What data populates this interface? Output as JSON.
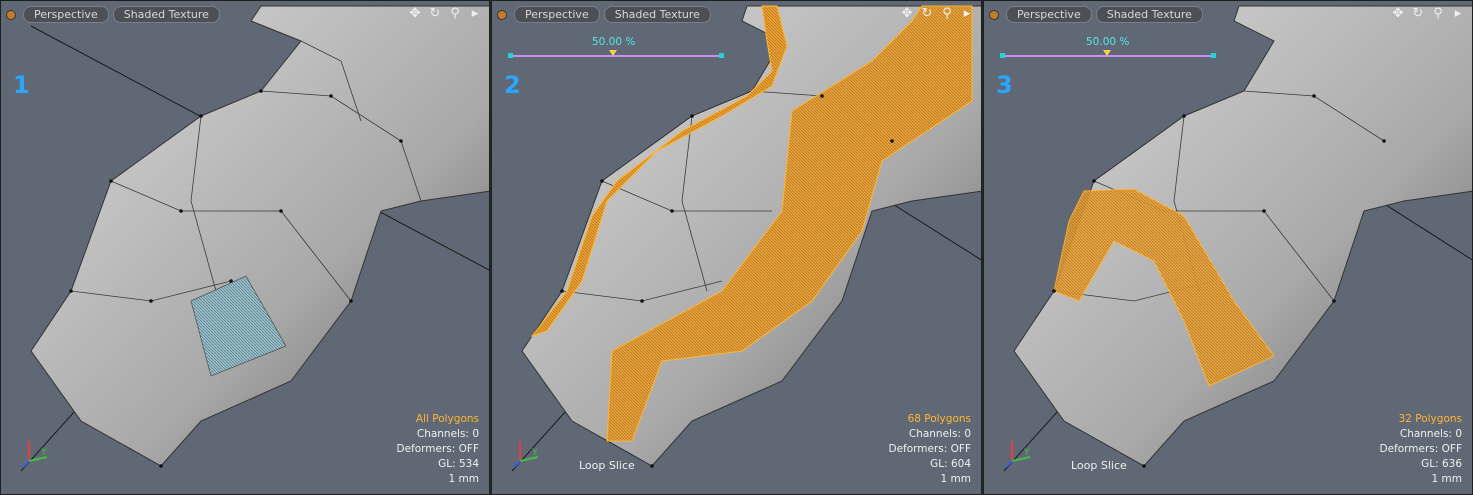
{
  "viewports": [
    {
      "number": "1",
      "view_label": "Perspective",
      "shading_label": "Shaded Texture",
      "selection": "All Polygons",
      "channels": "Channels: 0",
      "deformers": "Deformers: OFF",
      "gl": "GL: 534",
      "units": "1 mm",
      "tool_label": "",
      "slider_value": ""
    },
    {
      "number": "2",
      "view_label": "Perspective",
      "shading_label": "Shaded Texture",
      "selection": "68 Polygons",
      "channels": "Channels: 0",
      "deformers": "Deformers: OFF",
      "gl": "GL: 604",
      "units": "1 mm",
      "tool_label": "Loop Slice",
      "slider_value": "50.00 %"
    },
    {
      "number": "3",
      "view_label": "Perspective",
      "shading_label": "Shaded Texture",
      "selection": "32 Polygons",
      "channels": "Channels: 0",
      "deformers": "Deformers: OFF",
      "gl": "GL: 636",
      "units": "1 mm",
      "tool_label": "Loop Slice",
      "slider_value": "50.00 %"
    }
  ],
  "icons": [
    "menu-dot-icon",
    "move-icon",
    "rotate-icon",
    "zoom-icon",
    "expand-arrow-icon",
    "axis-gizmo-icon"
  ],
  "colors": {
    "viewport_bg": "#5f6874",
    "selection_orange": "#ffb733",
    "viewport_number_blue": "#2aa6ff",
    "slider_line": "#c98ff0",
    "slider_value_cyan": "#55e6e8"
  }
}
